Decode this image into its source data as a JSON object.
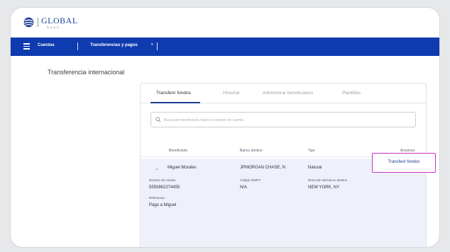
{
  "brand": {
    "name": "GLOBAL",
    "sub": "BANK"
  },
  "nav": {
    "cuentas": "Cuentas",
    "transferencias": "Transferencias y pagos"
  },
  "page": {
    "title": "Transferencia internacional"
  },
  "tabs": [
    {
      "label": "Transferir fondos"
    },
    {
      "label": "Historial"
    },
    {
      "label": "Administrar beneficiarios"
    },
    {
      "label": "Plantillas"
    }
  ],
  "search": {
    "placeholder": "Busca por beneficiario, banco o número de cuenta"
  },
  "table": {
    "headers": [
      "Beneficiario",
      "Banco destino",
      "Tipo",
      "Acciones"
    ],
    "row": {
      "beneficiario": "Miguel Morales",
      "banco": "JPMORGAN CHASE, N",
      "tipo": "Natural",
      "action": "Transferir fondos",
      "details": {
        "numero_cuenta_label": "Número de cuenta",
        "numero_cuenta": "5550862274455",
        "swift_label": "Código SWIFT",
        "swift": "N/A",
        "direccion_label": "Dirección del banco destino",
        "direccion": "NEW YORK, NY",
        "referencia_label": "Referencia",
        "referencia": "Pago a Miguel"
      }
    }
  },
  "colors": {
    "navbar": "#0f3bb0",
    "brand": "#1c3f94",
    "highlight": "#c431c9",
    "row": "#eef1f9"
  }
}
